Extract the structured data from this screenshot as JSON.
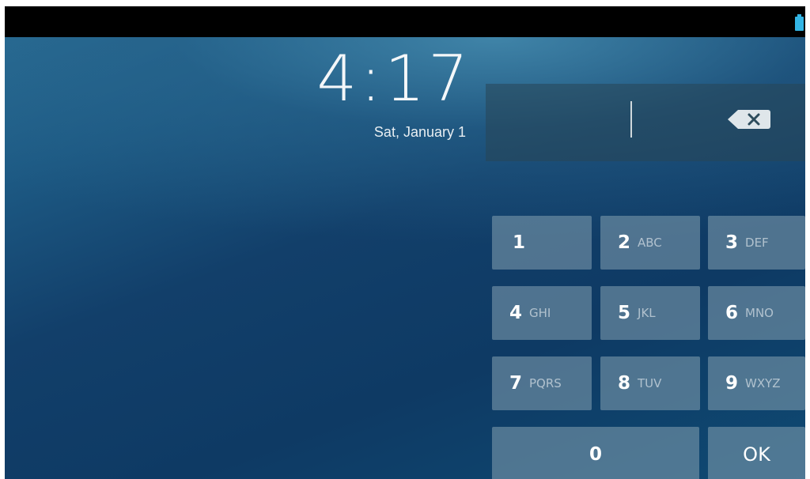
{
  "status_bar": {
    "battery_icon": "battery-icon",
    "accent": "#33b5e5"
  },
  "lockscreen": {
    "time": "4:17",
    "date": "Sat, January 1"
  },
  "pin_entry": {
    "value": "",
    "backspace_icon": "backspace-icon"
  },
  "keypad": {
    "keys": [
      {
        "digit": "1",
        "letters": ""
      },
      {
        "digit": "2",
        "letters": "ABC"
      },
      {
        "digit": "3",
        "letters": "DEF"
      },
      {
        "digit": "4",
        "letters": "GHI"
      },
      {
        "digit": "5",
        "letters": "JKL"
      },
      {
        "digit": "6",
        "letters": "MNO"
      },
      {
        "digit": "7",
        "letters": "PQRS"
      },
      {
        "digit": "8",
        "letters": "TUV"
      },
      {
        "digit": "9",
        "letters": "WXYZ"
      },
      {
        "digit": "0",
        "letters": ""
      }
    ],
    "ok_label": "OK"
  }
}
